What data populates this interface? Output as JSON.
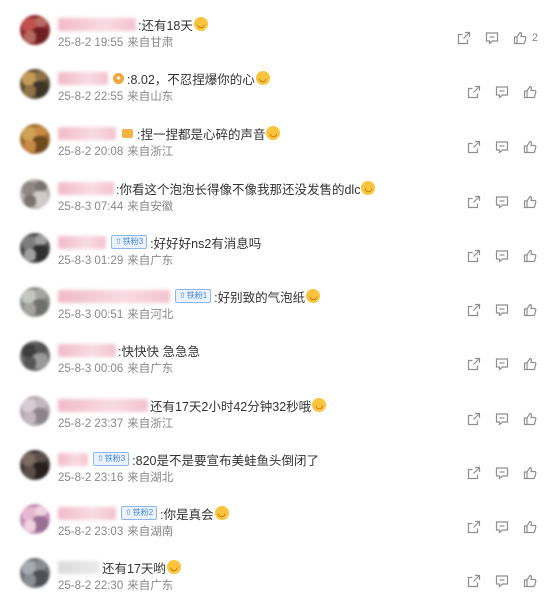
{
  "comments": [
    {
      "name_width": 78,
      "name_color": "pink",
      "badge": null,
      "icon": null,
      "text": ":还有18天",
      "emoji": true,
      "time": "25-8-2 19:55",
      "location": "来自甘肃",
      "likes": "2"
    },
    {
      "name_width": 50,
      "name_color": "pink",
      "badge": null,
      "icon": "medal",
      "text": ":8.02，不忍捏爆你的心",
      "emoji": true,
      "time": "25-8-2 22:55",
      "location": "来自山东",
      "likes": ""
    },
    {
      "name_width": 58,
      "name_color": "pink",
      "badge": null,
      "icon": "shop",
      "text": ":捏一捏都是心碎的声音",
      "emoji": true,
      "time": "25-8-2 20:08",
      "location": "来自浙江",
      "likes": ""
    },
    {
      "name_width": 56,
      "name_color": "pink",
      "badge": null,
      "icon": null,
      "text": ":你看这个泡泡长得像不像我那还没发售的dlc",
      "emoji": true,
      "time": "25-8-3 07:44",
      "location": "来自安徽",
      "likes": ""
    },
    {
      "name_width": 48,
      "name_color": "pink",
      "badge": "铁粉3",
      "icon": null,
      "text": ":好好好ns2有消息吗",
      "emoji": false,
      "time": "25-8-3 01:29",
      "location": "来自广东",
      "likes": ""
    },
    {
      "name_width": 112,
      "name_color": "pink",
      "badge": "铁粉1",
      "icon": null,
      "text": ":好别致的气泡纸",
      "emoji": true,
      "time": "25-8-3 00:51",
      "location": "来自河北",
      "likes": ""
    },
    {
      "name_width": 58,
      "name_color": "pink",
      "badge": null,
      "icon": null,
      "text": ":快快快  急急急",
      "emoji": false,
      "time": "25-8-3 00:06",
      "location": "来自广东",
      "likes": ""
    },
    {
      "name_width": 90,
      "name_color": "pink",
      "badge": null,
      "icon": null,
      "text": "还有17天2小时42分钟32秒哦",
      "emoji": true,
      "time": "25-8-2 23:37",
      "location": "来自浙江",
      "likes": ""
    },
    {
      "name_width": 30,
      "name_color": "pink",
      "badge": "铁粉3",
      "icon": null,
      "text": ":820是不是要宣布美蛙鱼头倒闭了",
      "emoji": false,
      "time": "25-8-2 23:16",
      "location": "来自湖北",
      "likes": ""
    },
    {
      "name_width": 58,
      "name_color": "pink",
      "badge": "铁粉2",
      "icon": null,
      "text": ":你是真会",
      "emoji": true,
      "time": "25-8-2 23:03",
      "location": "来自湖南",
      "likes": ""
    },
    {
      "name_width": 42,
      "name_color": "grey",
      "badge": null,
      "icon": null,
      "text": "还有17天哟",
      "emoji": true,
      "time": "25-8-2 22:30",
      "location": "来自广东",
      "likes": ""
    }
  ],
  "icons": {
    "share": "share-icon",
    "comment": "comment-icon",
    "like": "like-icon",
    "emoji": "smile-emoji-icon"
  },
  "colors": {
    "text": "#333333",
    "meta": "#888888",
    "name_pink": "#f3c2d0",
    "badge_blue": "#4a86d6",
    "emoji_yellow": "#fcc33d"
  }
}
